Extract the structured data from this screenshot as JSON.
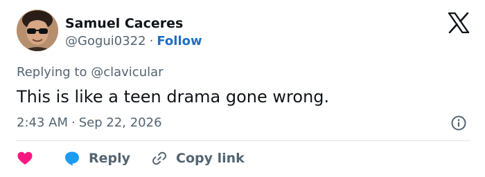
{
  "author": {
    "name": "Samuel Caceres",
    "handle": "@Gogui0322",
    "separator": "·",
    "follow_label": "Follow"
  },
  "tweet": {
    "reply_prefix": "Replying to",
    "reply_handle": "@clavicular",
    "text": "This is like a teen drama gone wrong.",
    "time": "2:43 AM",
    "time_separator": "·",
    "date": "Sep 22, 2026"
  },
  "actions": {
    "reply_label": "Reply",
    "copy_link_label": "Copy link"
  },
  "icons": {
    "brand": "x-logo-icon",
    "info": "info-icon",
    "like": "heart-icon",
    "reply": "speech-bubble-icon",
    "copy": "link-icon"
  },
  "colors": {
    "text_primary": "#0f1419",
    "text_secondary": "#536471",
    "follow": "#1d6fc4",
    "like": "#f91880",
    "reply": "#1d9bf0",
    "divider": "#e1e6ea"
  }
}
